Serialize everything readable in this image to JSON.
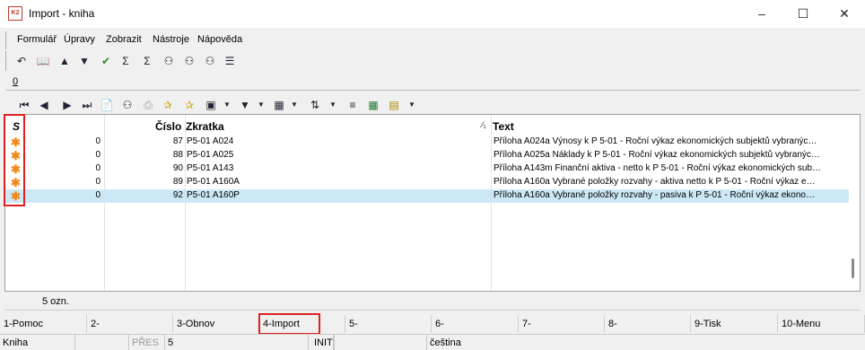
{
  "window": {
    "title": "Import - kniha",
    "logo": "K2"
  },
  "menu": [
    {
      "label": "Formulář",
      "u": "F"
    },
    {
      "label": "Úpravy",
      "u": "Ú"
    },
    {
      "label": "Zobrazit",
      "u": "Z"
    },
    {
      "label": "Nástroje",
      "u": "N"
    },
    {
      "label": "Nápověda",
      "u": "v"
    }
  ],
  "tab": {
    "label": "0"
  },
  "grid": {
    "headers": {
      "s": "S",
      "cislo": "Číslo",
      "zkratka": "Zkratka",
      "text": "Text",
      "sort_indicator": "⁄₁"
    },
    "rows": [
      {
        "s": "✱",
        "c0": "0",
        "cislo": "87",
        "zkratka": "P5-01 A024",
        "text": "Příloha A024a Výnosy k P 5-01 - Roční výkaz ekonomických subjektů vybranýc…"
      },
      {
        "s": "✱",
        "c0": "0",
        "cislo": "88",
        "zkratka": "P5-01 A025",
        "text": "Příloha A025a Náklady k P 5-01 - Roční výkaz ekonomických subjektů vybranýc…"
      },
      {
        "s": "✱",
        "c0": "0",
        "cislo": "90",
        "zkratka": "P5-01 A143",
        "text": "Příloha A143m Finanční aktiva - netto k P 5-01 - Roční výkaz ekonomických sub…"
      },
      {
        "s": "✱",
        "c0": "0",
        "cislo": "89",
        "zkratka": "P5-01 A160A",
        "text": "Příloha A160a Vybrané položky rozvahy - aktiva netto k P 5-01 - Roční výkaz e…"
      },
      {
        "s": "✱",
        "c0": "0",
        "cislo": "92",
        "zkratka": "P5-01 A160P",
        "text": "Příloha A160a Vybrané položky rozvahy - pasiva k P 5-01 - Roční výkaz ekono…"
      }
    ]
  },
  "count_label": "5 ozn.",
  "fkeys": [
    "1-Pomoc",
    "2-",
    "3-Obnov",
    "4-Import",
    "5-",
    "6-",
    "7-",
    "8-",
    "9-Tisk",
    "10-Menu"
  ],
  "status": {
    "s1": "Kniha",
    "s2": "",
    "s3": "PŘES",
    "s4": "5",
    "s5": "INIT",
    "s6": "",
    "s7": "čeština"
  },
  "colors": {
    "highlight": "#e02020",
    "selected_row": "#cde8f5",
    "star": "#f08a1c"
  },
  "icons": {
    "toolbar1": [
      "undo-icon",
      "book-icon",
      "arrow-up-icon",
      "arrow-down-icon",
      "recalc-icon",
      "sum-icon",
      "sum-filter-icon",
      "binoculars-icon",
      "binoculars-next-icon",
      "binoculars-settings-icon",
      "menu-lines-icon"
    ],
    "toolbar2": [
      "first-record-icon",
      "prev-record-icon",
      "next-record-icon",
      "last-record-icon",
      "document-icon",
      "find-icon",
      "print-icon",
      "star-add-icon",
      "star-remove-icon",
      "camera-icon",
      "filter-icon",
      "table-icon",
      "sort-az-icon",
      "list-icon",
      "excel-icon",
      "report-icon"
    ]
  }
}
